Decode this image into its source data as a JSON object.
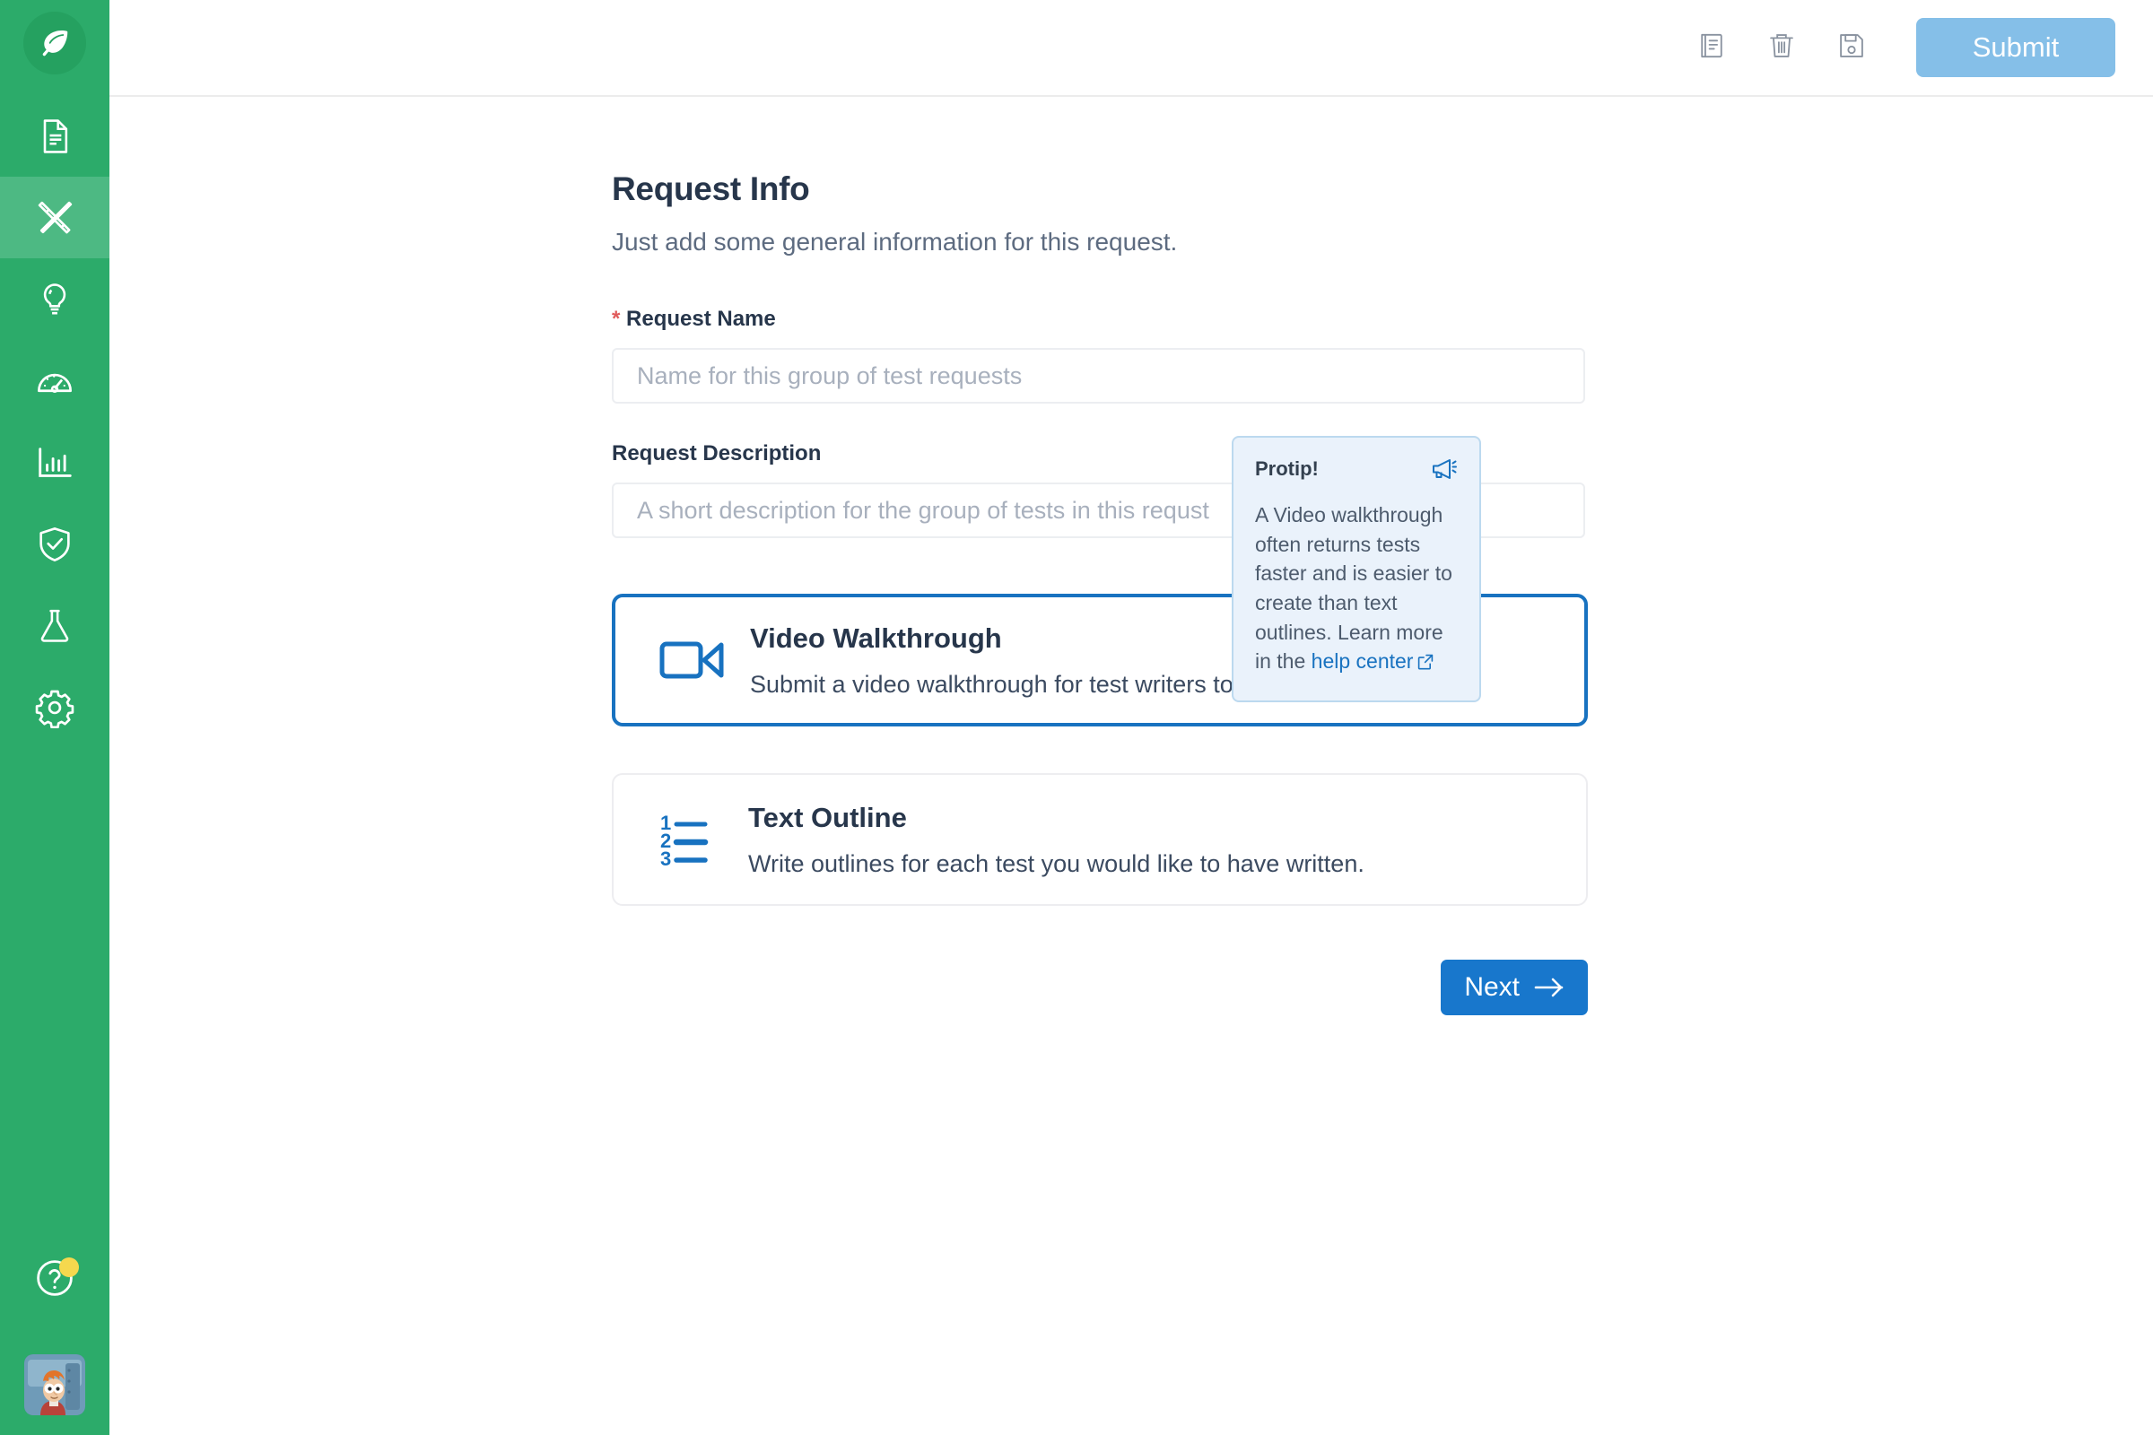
{
  "sidebar": {
    "logo": {
      "icon": "leaf-logo-icon"
    },
    "items": [
      {
        "icon": "document-icon",
        "name": "documents",
        "active": false
      },
      {
        "icon": "tools-pencil-ruler-icon",
        "name": "authoring",
        "active": true
      },
      {
        "icon": "lightbulb-icon",
        "name": "ideas",
        "active": false
      },
      {
        "icon": "gauge-icon",
        "name": "performance",
        "active": false
      },
      {
        "icon": "bar-chart-icon",
        "name": "analytics",
        "active": false
      },
      {
        "icon": "shield-check-icon",
        "name": "security",
        "active": false
      },
      {
        "icon": "flask-icon",
        "name": "experiments",
        "active": false
      },
      {
        "icon": "gear-icon",
        "name": "settings",
        "active": false
      }
    ],
    "help": {
      "icon": "question-circle-icon",
      "has_notification": true
    },
    "avatar": {
      "icon": "user-avatar"
    },
    "colors": {
      "background": "#2cab6a",
      "active_background": "#4db983",
      "logo_background": "#25a160",
      "notification_dot": "#f5d84e"
    }
  },
  "topbar": {
    "icons": [
      {
        "icon": "book-notes-icon",
        "name": "notes"
      },
      {
        "icon": "trash-icon",
        "name": "delete"
      },
      {
        "icon": "floppy-save-icon",
        "name": "save"
      }
    ],
    "submit_label": "Submit",
    "submit_color": "#85bfe8"
  },
  "main": {
    "title": "Request Info",
    "subtitle": "Just add some general information for this request.",
    "fields": [
      {
        "label": "Request Name",
        "required": true,
        "required_marker": "*",
        "value": "",
        "placeholder": "Name for this group of test requests"
      },
      {
        "label": "Request Description",
        "required": false,
        "required_marker": "",
        "value": "",
        "placeholder": "A short description for the group of tests in this requst"
      }
    ],
    "options": [
      {
        "title": "Video Walkthrough",
        "description": "Submit a video walkthrough for test writers to create tests.",
        "icon": "video-camera-icon",
        "selected": true
      },
      {
        "title": "Text Outline",
        "description": "Write outlines for each test you would like to have written.",
        "icon": "numbered-list-icon",
        "selected": false
      }
    ],
    "next_label": "Next",
    "next_color": "#1877cc"
  },
  "protip": {
    "title": "Protip!",
    "icon": "megaphone-icon",
    "body_before_link": "A Video walkthrough often returns tests faster and is easier to create than text outlines. Learn more in the ",
    "link_label": "help center",
    "link_icon": "external-link-icon",
    "background": "#eaf2fb",
    "border": "#bcd9ef"
  },
  "icon_numbers": {
    "one": "1",
    "two": "2",
    "three": "3"
  }
}
